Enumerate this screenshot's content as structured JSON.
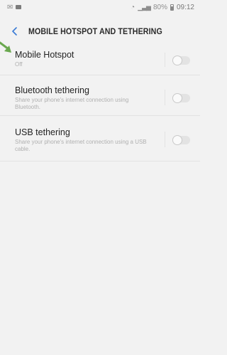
{
  "status_bar": {
    "battery_percent": "80%",
    "time": "09:12"
  },
  "header": {
    "title": "MOBILE HOTSPOT AND TETHERING"
  },
  "settings": [
    {
      "label": "Mobile Hotspot",
      "sub": "Off",
      "toggle_on": false
    },
    {
      "label": "Bluetooth tethering",
      "sub": "Share your phone's internet connection using Bluetooth.",
      "toggle_on": false
    },
    {
      "label": "USB tethering",
      "sub": "Share your phone's internet connection using a USB cable.",
      "toggle_on": false
    }
  ],
  "colors": {
    "background": "#f2f2f2",
    "annotation_arrow": "#6aa84f",
    "toggle_off_track": "#e3e3e3"
  }
}
